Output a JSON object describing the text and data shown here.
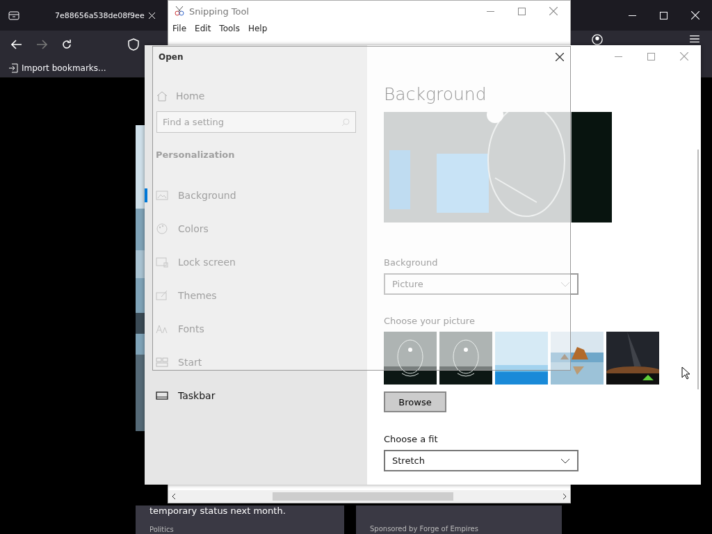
{
  "browser": {
    "tabs": [
      {
        "title": "7e88656a538de08f9ee"
      }
    ],
    "bookmarks": [
      {
        "label": "Import bookmarks..."
      }
    ],
    "page": {
      "headline": "temporary status next month.",
      "category": "Politics",
      "sponsor": "Sponsored by Forge of Empires"
    }
  },
  "snipping_tool": {
    "title": "Snipping Tool",
    "menu": [
      "File",
      "Edit",
      "Tools",
      "Help"
    ]
  },
  "settings": {
    "nav": {
      "home": "Home",
      "search_placeholder": "Find a setting",
      "section": "Personalization",
      "items": [
        {
          "label": "Background",
          "selected": true
        },
        {
          "label": "Colors",
          "selected": false
        },
        {
          "label": "Lock screen",
          "selected": false
        },
        {
          "label": "Themes",
          "selected": false
        },
        {
          "label": "Fonts",
          "selected": false
        },
        {
          "label": "Start",
          "selected": false
        },
        {
          "label": "Taskbar",
          "selected": false
        }
      ]
    },
    "content": {
      "title": "Background",
      "background_label": "Background",
      "background_value": "Picture",
      "choose_label": "Choose your picture",
      "thumbnails": [
        {
          "kind": "face"
        },
        {
          "kind": "face"
        },
        {
          "kind": "sky"
        },
        {
          "kind": "coast"
        },
        {
          "kind": "night"
        }
      ],
      "browse": "Browse",
      "fit_label": "Choose a fit",
      "fit_value": "Stretch"
    }
  },
  "open_dialog": {
    "title": "Open"
  }
}
